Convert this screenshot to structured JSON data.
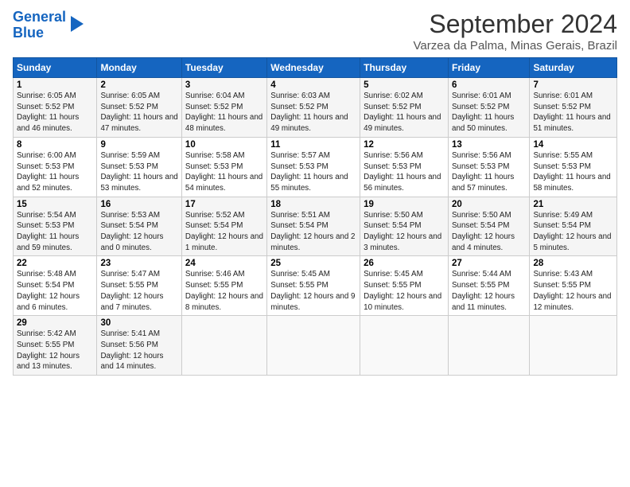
{
  "logo": {
    "line1": "General",
    "line2": "Blue"
  },
  "title": "September 2024",
  "location": "Varzea da Palma, Minas Gerais, Brazil",
  "weekdays": [
    "Sunday",
    "Monday",
    "Tuesday",
    "Wednesday",
    "Thursday",
    "Friday",
    "Saturday"
  ],
  "weeks": [
    [
      {
        "day": "1",
        "sunrise": "6:05 AM",
        "sunset": "5:52 PM",
        "daylight": "11 hours and 46 minutes."
      },
      {
        "day": "2",
        "sunrise": "6:05 AM",
        "sunset": "5:52 PM",
        "daylight": "11 hours and 47 minutes."
      },
      {
        "day": "3",
        "sunrise": "6:04 AM",
        "sunset": "5:52 PM",
        "daylight": "11 hours and 48 minutes."
      },
      {
        "day": "4",
        "sunrise": "6:03 AM",
        "sunset": "5:52 PM",
        "daylight": "11 hours and 49 minutes."
      },
      {
        "day": "5",
        "sunrise": "6:02 AM",
        "sunset": "5:52 PM",
        "daylight": "11 hours and 49 minutes."
      },
      {
        "day": "6",
        "sunrise": "6:01 AM",
        "sunset": "5:52 PM",
        "daylight": "11 hours and 50 minutes."
      },
      {
        "day": "7",
        "sunrise": "6:01 AM",
        "sunset": "5:52 PM",
        "daylight": "11 hours and 51 minutes."
      }
    ],
    [
      {
        "day": "8",
        "sunrise": "6:00 AM",
        "sunset": "5:53 PM",
        "daylight": "11 hours and 52 minutes."
      },
      {
        "day": "9",
        "sunrise": "5:59 AM",
        "sunset": "5:53 PM",
        "daylight": "11 hours and 53 minutes."
      },
      {
        "day": "10",
        "sunrise": "5:58 AM",
        "sunset": "5:53 PM",
        "daylight": "11 hours and 54 minutes."
      },
      {
        "day": "11",
        "sunrise": "5:57 AM",
        "sunset": "5:53 PM",
        "daylight": "11 hours and 55 minutes."
      },
      {
        "day": "12",
        "sunrise": "5:56 AM",
        "sunset": "5:53 PM",
        "daylight": "11 hours and 56 minutes."
      },
      {
        "day": "13",
        "sunrise": "5:56 AM",
        "sunset": "5:53 PM",
        "daylight": "11 hours and 57 minutes."
      },
      {
        "day": "14",
        "sunrise": "5:55 AM",
        "sunset": "5:53 PM",
        "daylight": "11 hours and 58 minutes."
      }
    ],
    [
      {
        "day": "15",
        "sunrise": "5:54 AM",
        "sunset": "5:53 PM",
        "daylight": "11 hours and 59 minutes."
      },
      {
        "day": "16",
        "sunrise": "5:53 AM",
        "sunset": "5:54 PM",
        "daylight": "12 hours and 0 minutes."
      },
      {
        "day": "17",
        "sunrise": "5:52 AM",
        "sunset": "5:54 PM",
        "daylight": "12 hours and 1 minute."
      },
      {
        "day": "18",
        "sunrise": "5:51 AM",
        "sunset": "5:54 PM",
        "daylight": "12 hours and 2 minutes."
      },
      {
        "day": "19",
        "sunrise": "5:50 AM",
        "sunset": "5:54 PM",
        "daylight": "12 hours and 3 minutes."
      },
      {
        "day": "20",
        "sunrise": "5:50 AM",
        "sunset": "5:54 PM",
        "daylight": "12 hours and 4 minutes."
      },
      {
        "day": "21",
        "sunrise": "5:49 AM",
        "sunset": "5:54 PM",
        "daylight": "12 hours and 5 minutes."
      }
    ],
    [
      {
        "day": "22",
        "sunrise": "5:48 AM",
        "sunset": "5:54 PM",
        "daylight": "12 hours and 6 minutes."
      },
      {
        "day": "23",
        "sunrise": "5:47 AM",
        "sunset": "5:55 PM",
        "daylight": "12 hours and 7 minutes."
      },
      {
        "day": "24",
        "sunrise": "5:46 AM",
        "sunset": "5:55 PM",
        "daylight": "12 hours and 8 minutes."
      },
      {
        "day": "25",
        "sunrise": "5:45 AM",
        "sunset": "5:55 PM",
        "daylight": "12 hours and 9 minutes."
      },
      {
        "day": "26",
        "sunrise": "5:45 AM",
        "sunset": "5:55 PM",
        "daylight": "12 hours and 10 minutes."
      },
      {
        "day": "27",
        "sunrise": "5:44 AM",
        "sunset": "5:55 PM",
        "daylight": "12 hours and 11 minutes."
      },
      {
        "day": "28",
        "sunrise": "5:43 AM",
        "sunset": "5:55 PM",
        "daylight": "12 hours and 12 minutes."
      }
    ],
    [
      {
        "day": "29",
        "sunrise": "5:42 AM",
        "sunset": "5:55 PM",
        "daylight": "12 hours and 13 minutes."
      },
      {
        "day": "30",
        "sunrise": "5:41 AM",
        "sunset": "5:56 PM",
        "daylight": "12 hours and 14 minutes."
      },
      null,
      null,
      null,
      null,
      null
    ]
  ],
  "labels": {
    "sunrise": "Sunrise:",
    "sunset": "Sunset:",
    "daylight": "Daylight:"
  }
}
